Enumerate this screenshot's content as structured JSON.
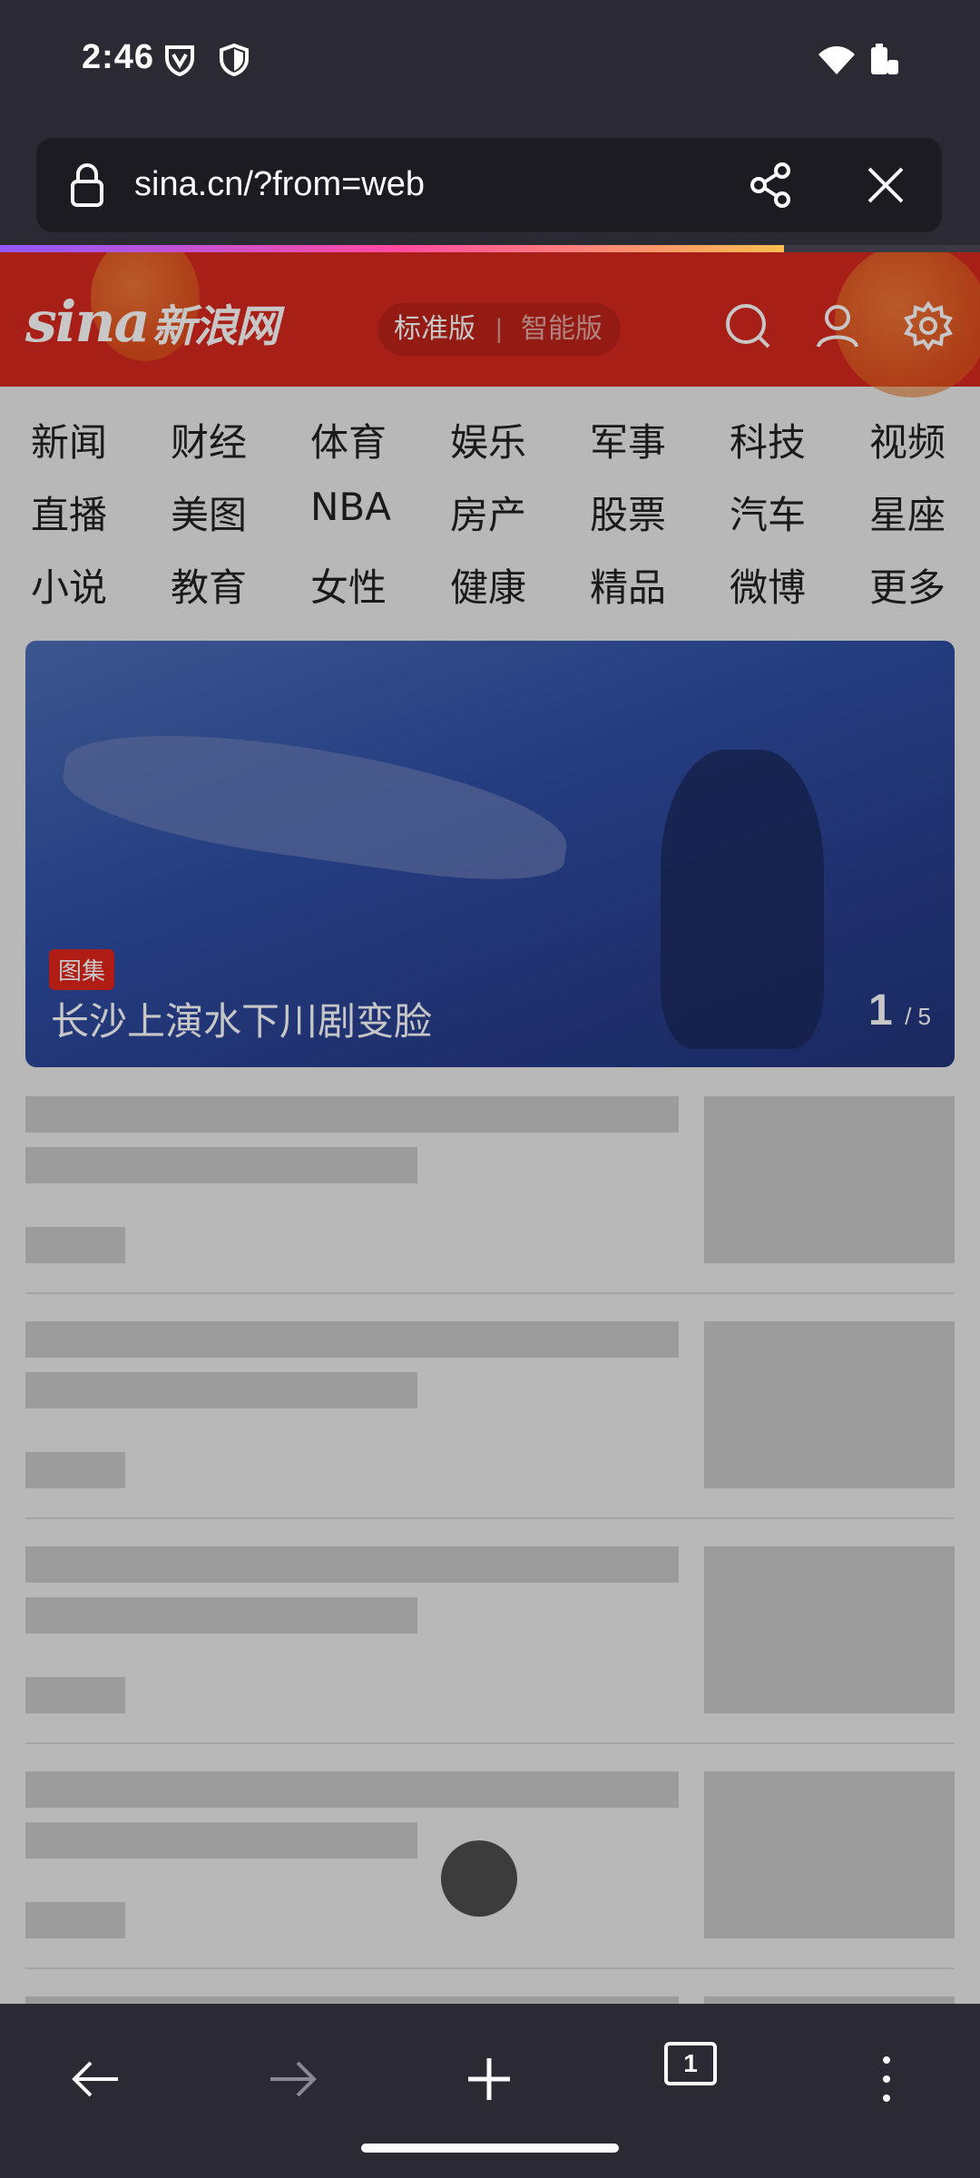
{
  "status_bar": {
    "time": "2:46"
  },
  "url_bar": {
    "url": "sina.cn/?from=web"
  },
  "page_load_progress": 0.8,
  "header": {
    "logo_latin": "sina",
    "logo_cn": "新浪网",
    "mode_standard": "标准版",
    "mode_separator": "|",
    "mode_smart": "智能版"
  },
  "nav": {
    "rows": [
      [
        "新闻",
        "财经",
        "体育",
        "娱乐",
        "军事",
        "科技",
        "视频"
      ],
      [
        "直播",
        "美图",
        "NBA",
        "房产",
        "股票",
        "汽车",
        "星座"
      ],
      [
        "小说",
        "教育",
        "女性",
        "健康",
        "精品",
        "微博",
        "更多"
      ]
    ]
  },
  "hero": {
    "tag": "图集",
    "title": "长沙上演水下川剧变脸",
    "page_current": "1",
    "page_total": "/ 5"
  },
  "toolbar": {
    "tab_count": "1"
  },
  "colors": {
    "brand_red": "#d8281e",
    "chrome_bg": "#2b2a33",
    "url_bg": "#1c1b22"
  }
}
